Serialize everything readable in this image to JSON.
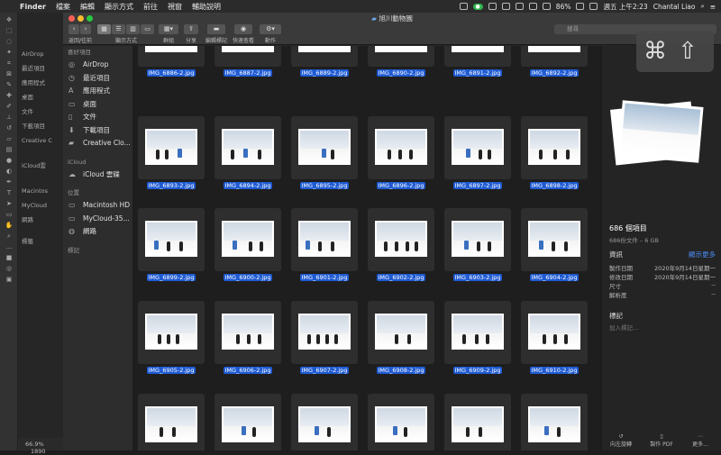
{
  "menubar": {
    "apple": "",
    "app": "Finder",
    "items": [
      "檔案",
      "編輯",
      "顯示方式",
      "前往",
      "視窗",
      "輔助說明"
    ],
    "battery": "86%",
    "datetime": "週五 上午2:23",
    "user": "Chantal Liao"
  },
  "ps": {
    "zoom": "66.9%",
    "zoom2": "1890",
    "sideItems": [
      "AirDrop",
      "最近項目",
      "應用程式",
      "桌面",
      "文件",
      "下載項目",
      "Creative C",
      "iCloud雲",
      "Macintos",
      "MyCloud",
      "網路",
      "標籤"
    ]
  },
  "finder": {
    "title": "旭川動物園",
    "toolbar": {
      "back_fwd": "返回/往前",
      "view": "顯示方式",
      "group": "群組",
      "share": "分享",
      "edit_tags": "編輯標記",
      "quicklook": "快速查看",
      "action": "動作",
      "search_placeholder": "搜尋"
    },
    "sidebar": {
      "favorites": "喜好項目",
      "fav_items": [
        "AirDrop",
        "最近項目",
        "應用程式",
        "桌面",
        "文件",
        "下載項目",
        "Creative Clo..."
      ],
      "icloud": "iCloud",
      "icloud_items": [
        "iCloud 雲碟"
      ],
      "locations": "位置",
      "loc_items": [
        "Macintosh HD",
        "MyCloud-35...",
        "網路"
      ],
      "tags": "標記"
    },
    "partial_names": [
      "IMG_6886-2.jpg",
      "IMG_6887-2.jpg",
      "IMG_6889-2.jpg",
      "IMG_6890-2.jpg",
      "IMG_6891-2.jpg",
      "IMG_6892-2.jpg"
    ],
    "rows": [
      [
        "IMG_6893-2.jpg",
        "IMG_6894-2.jpg",
        "IMG_6895-2.jpg",
        "IMG_6896-2.jpg",
        "IMG_6897-2.jpg",
        "IMG_6898-2.jpg"
      ],
      [
        "IMG_6899-2.jpg",
        "IMG_6900-2.jpg",
        "IMG_6901-2.jpg",
        "IMG_6902-2.jpg",
        "IMG_6903-2.jpg",
        "IMG_6904-2.jpg"
      ],
      [
        "IMG_6905-2.jpg",
        "IMG_6906-2.jpg",
        "IMG_6907-2.jpg",
        "IMG_6908-2.jpg",
        "IMG_6909-2.jpg",
        "IMG_6910-2.jpg"
      ]
    ],
    "info": {
      "count": "686 個項目",
      "sub": "686份文件 – 6 GB",
      "section": "資訊",
      "more": "顯示更多",
      "created_k": "製作日期",
      "created_v": "2020年9月14日星期一",
      "modified_k": "修改日期",
      "modified_v": "2020年9月14日星期一",
      "size_k": "尺寸",
      "size_v": "--",
      "res_k": "解析度",
      "res_v": "--",
      "tags_h": "標記",
      "add_tag": "加入標記…",
      "rotate": "向左旋轉",
      "pdf": "製作 PDF",
      "more_btn": "更多..."
    }
  },
  "overlay": {
    "cmd": "⌘",
    "shift": "⇧"
  }
}
